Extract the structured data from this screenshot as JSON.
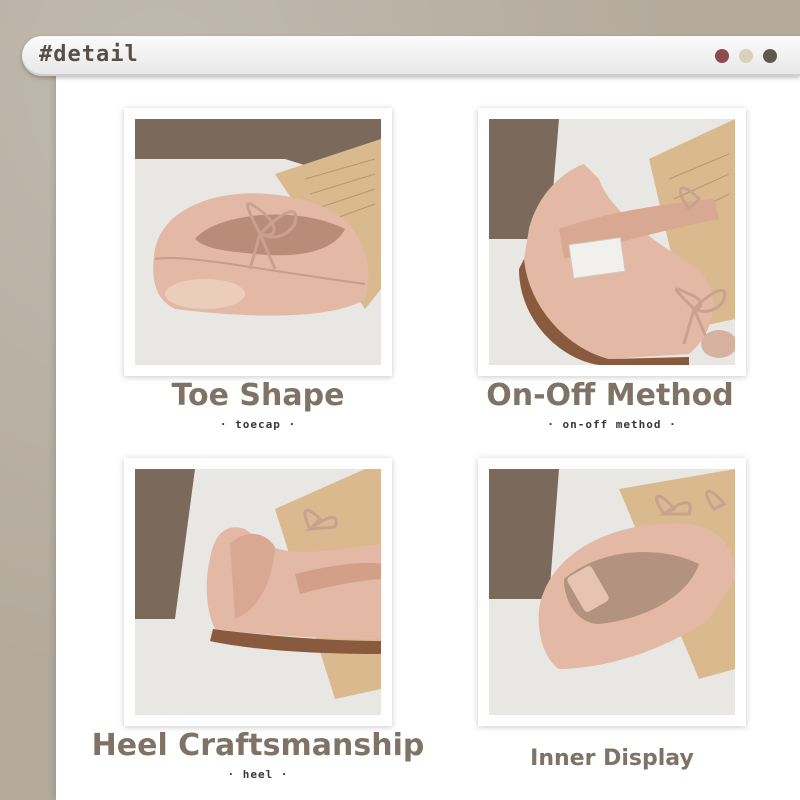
{
  "header": {
    "title": "#detail",
    "colors": [
      "#8e4a4f",
      "#d8d0b9",
      "#5e5a50"
    ]
  },
  "panels": [
    {
      "photo_icon": "toe-shape-photo",
      "caption": "Toe Shape",
      "subtitle": "· toecap ·"
    },
    {
      "photo_icon": "on-off-photo",
      "caption": "On-Off Method",
      "subtitle": "· on-off method ·"
    },
    {
      "photo_icon": "heel-photo",
      "caption": "Heel Craftsmanship",
      "subtitle": "· heel ·"
    },
    {
      "photo_icon": "inner-photo",
      "caption": "Inner Display",
      "subtitle": ""
    }
  ],
  "colors": {
    "leather": "#e3b9a6",
    "sole": "#8a5a3e",
    "caption": "#7f7366"
  }
}
